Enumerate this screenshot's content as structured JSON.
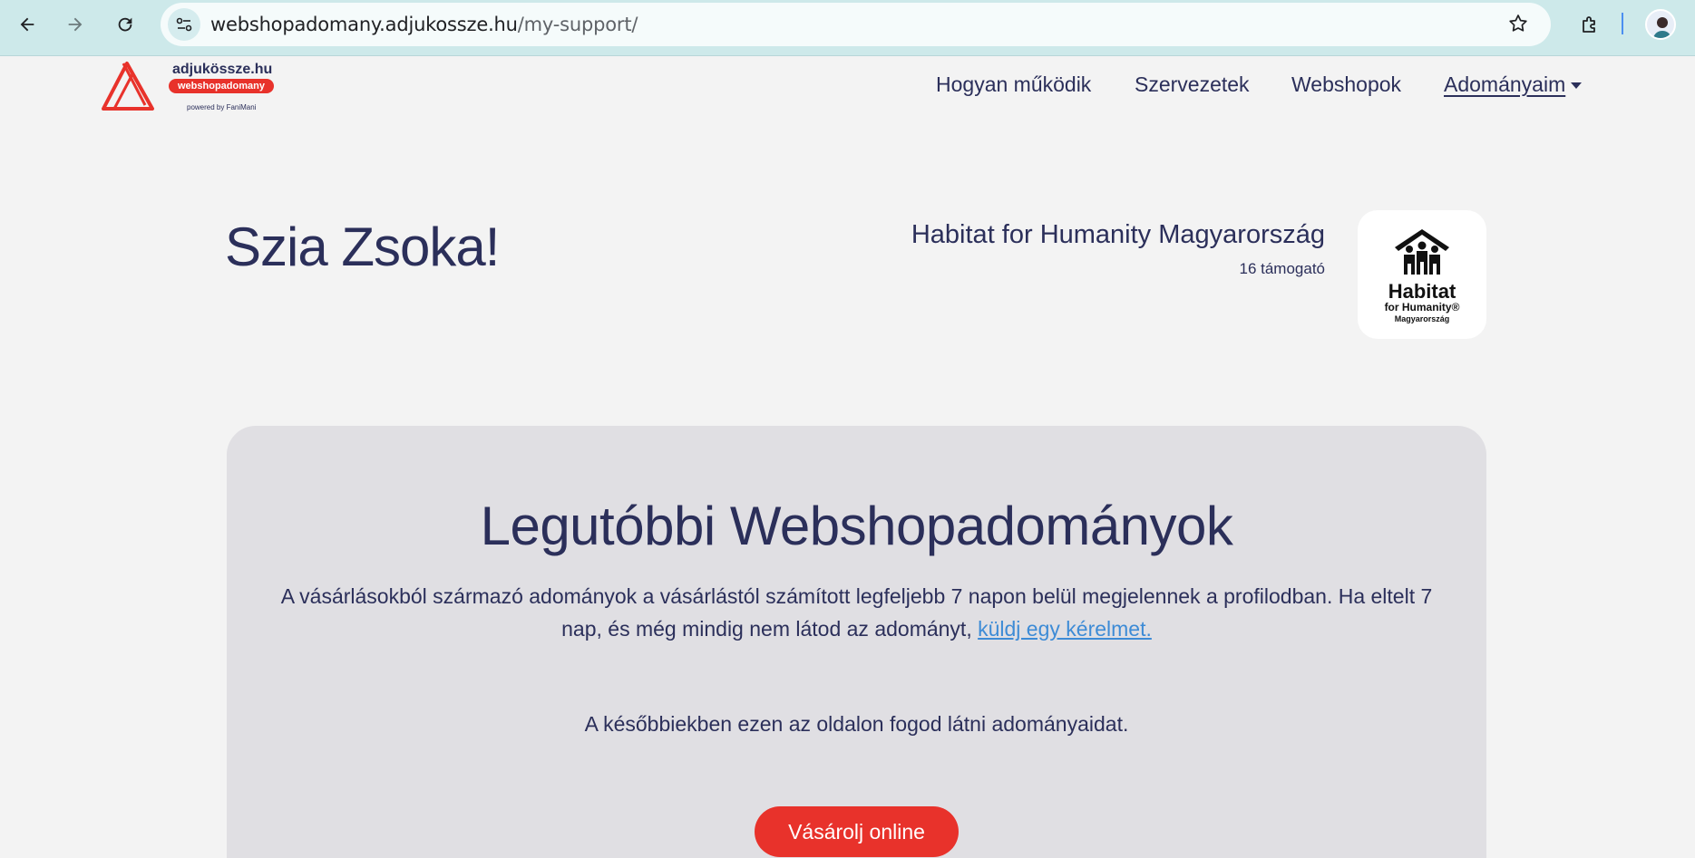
{
  "browser": {
    "url_domain": "webshopadomany.adjukossze.hu",
    "url_path": "/my-support/"
  },
  "site": {
    "logo_name": "adjukössze.hu",
    "logo_badge": "webshopadomany",
    "logo_powered": "powered by FaniMani",
    "nav": [
      {
        "label": "Hogyan működik"
      },
      {
        "label": "Szervezetek"
      },
      {
        "label": "Webshopok"
      },
      {
        "label": "Adományaim"
      }
    ]
  },
  "profile": {
    "greeting": "Szia Zsoka!",
    "org_name": "Habitat for Humanity Magyarország",
    "org_supporters": "16 támogató",
    "org_logo": {
      "line1": "Habitat",
      "line2": "for Humanity®",
      "line3": "Magyarország"
    }
  },
  "card": {
    "title": "Legutóbbi Webshopadományok",
    "desc": "A vásárlásokból származó adományok a vásárlástól számított legfeljebb 7 napon belül megjelennek a profilodban. Ha eltelt 7 nap, és még mindig nem látod az adományt,",
    "link": "küldj egy kérelmet.",
    "note": "A későbbiekben ezen az oldalon fogod látni adományaidat.",
    "cta": "Vásárolj online"
  },
  "colors": {
    "accent": "#e8322b",
    "text": "#2b2f5a",
    "link": "#3d8bd6"
  }
}
